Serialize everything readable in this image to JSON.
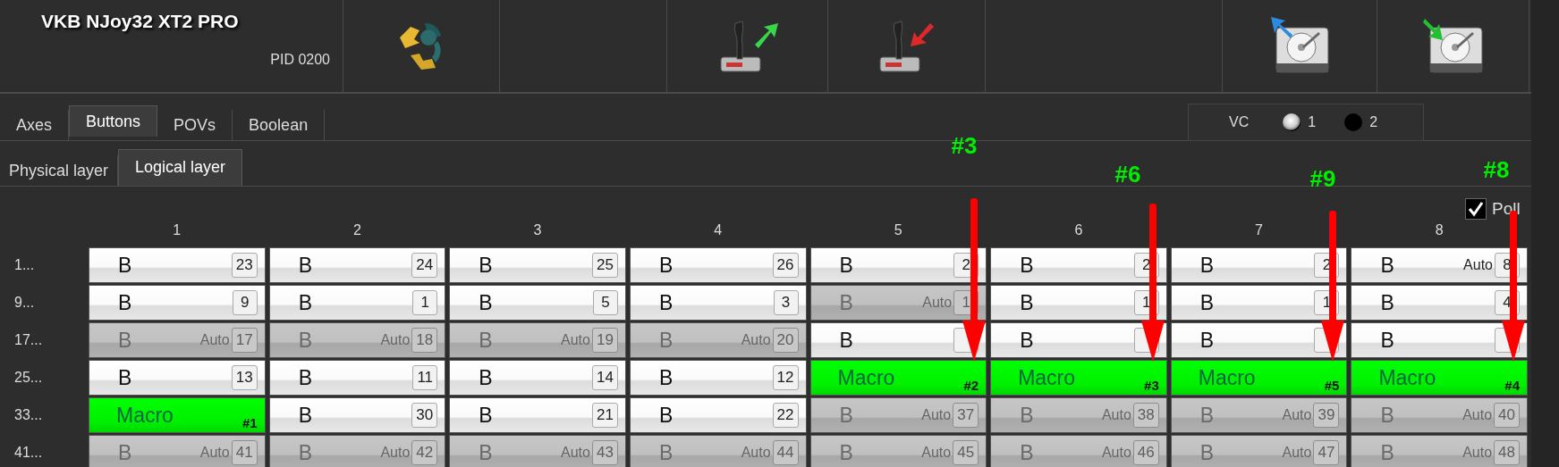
{
  "device": {
    "name": "VKB NJoy32 XT2 PRO",
    "pid": "PID 0200"
  },
  "tabs": [
    {
      "label": "Axes",
      "selected": false
    },
    {
      "label": "Buttons",
      "selected": true
    },
    {
      "label": "POVs",
      "selected": false
    },
    {
      "label": "Boolean",
      "selected": false
    }
  ],
  "vc": {
    "label": "VC",
    "options": [
      {
        "label": "1",
        "selected": true
      },
      {
        "label": "2",
        "selected": false
      }
    ]
  },
  "layer_tabs": [
    {
      "label": "Physical layer",
      "selected": false
    },
    {
      "label": "Logical layer",
      "selected": true
    }
  ],
  "poll": {
    "label": "Poll",
    "checked": true
  },
  "columns": [
    "1",
    "2",
    "3",
    "4",
    "5",
    "6",
    "7",
    "8"
  ],
  "rows": [
    {
      "label": "1...",
      "cells": [
        {
          "kind": "button",
          "text": "B",
          "number": "23",
          "disabled": false
        },
        {
          "kind": "button",
          "text": "B",
          "number": "24",
          "disabled": false
        },
        {
          "kind": "button",
          "text": "B",
          "number": "25",
          "disabled": false
        },
        {
          "kind": "button",
          "text": "B",
          "number": "26",
          "disabled": false
        },
        {
          "kind": "button",
          "text": "B",
          "number": "2",
          "disabled": false
        },
        {
          "kind": "button",
          "text": "B",
          "number": "2",
          "disabled": false
        },
        {
          "kind": "button",
          "text": "B",
          "number": "2",
          "disabled": false
        },
        {
          "kind": "button",
          "text": "B",
          "auto": "Auto",
          "number": "8",
          "disabled": false
        }
      ]
    },
    {
      "label": "9...",
      "cells": [
        {
          "kind": "button",
          "text": "B",
          "number": "9",
          "disabled": false
        },
        {
          "kind": "button",
          "text": "B",
          "number": "1",
          "disabled": false
        },
        {
          "kind": "button",
          "text": "B",
          "number": "5",
          "disabled": false
        },
        {
          "kind": "button",
          "text": "B",
          "number": "3",
          "disabled": false
        },
        {
          "kind": "button",
          "text": "B",
          "auto": "Auto",
          "number": "1",
          "disabled": true
        },
        {
          "kind": "button",
          "text": "B",
          "number": "1",
          "disabled": false
        },
        {
          "kind": "button",
          "text": "B",
          "number": "1",
          "disabled": false
        },
        {
          "kind": "button",
          "text": "B",
          "number": "4",
          "disabled": false
        }
      ]
    },
    {
      "label": "17...",
      "cells": [
        {
          "kind": "button",
          "text": "B",
          "auto": "Auto",
          "number": "17",
          "disabled": true
        },
        {
          "kind": "button",
          "text": "B",
          "auto": "Auto",
          "number": "18",
          "disabled": true
        },
        {
          "kind": "button",
          "text": "B",
          "auto": "Auto",
          "number": "19",
          "disabled": true
        },
        {
          "kind": "button",
          "text": "B",
          "auto": "Auto",
          "number": "20",
          "disabled": true
        },
        {
          "kind": "button",
          "text": "B",
          "disabled": false
        },
        {
          "kind": "button",
          "text": "B",
          "disabled": false
        },
        {
          "kind": "button",
          "text": "B",
          "disabled": false
        },
        {
          "kind": "button",
          "text": "B",
          "disabled": false
        }
      ]
    },
    {
      "label": "25...",
      "cells": [
        {
          "kind": "button",
          "text": "B",
          "number": "13",
          "disabled": false
        },
        {
          "kind": "button",
          "text": "B",
          "number": "11",
          "disabled": false
        },
        {
          "kind": "button",
          "text": "B",
          "number": "14",
          "disabled": false
        },
        {
          "kind": "button",
          "text": "B",
          "number": "12",
          "disabled": false
        },
        {
          "kind": "macro",
          "text": "Macro",
          "tag": "#2"
        },
        {
          "kind": "macro",
          "text": "Macro",
          "tag": "#3"
        },
        {
          "kind": "macro",
          "text": "Macro",
          "tag": "#5"
        },
        {
          "kind": "macro",
          "text": "Macro",
          "tag": "#4"
        }
      ]
    },
    {
      "label": "33...",
      "cells": [
        {
          "kind": "macro",
          "text": "Macro",
          "tag": "#1"
        },
        {
          "kind": "button",
          "text": "B",
          "number": "30",
          "disabled": false
        },
        {
          "kind": "button",
          "text": "B",
          "number": "21",
          "disabled": false
        },
        {
          "kind": "button",
          "text": "B",
          "number": "22",
          "disabled": false
        },
        {
          "kind": "button",
          "text": "B",
          "auto": "Auto",
          "number": "37",
          "disabled": true
        },
        {
          "kind": "button",
          "text": "B",
          "auto": "Auto",
          "number": "38",
          "disabled": true
        },
        {
          "kind": "button",
          "text": "B",
          "auto": "Auto",
          "number": "39",
          "disabled": true
        },
        {
          "kind": "button",
          "text": "B",
          "auto": "Auto",
          "number": "40",
          "disabled": true
        }
      ]
    },
    {
      "label": "41...",
      "cells": [
        {
          "kind": "button",
          "text": "B",
          "auto": "Auto",
          "number": "41",
          "disabled": true
        },
        {
          "kind": "button",
          "text": "B",
          "auto": "Auto",
          "number": "42",
          "disabled": true
        },
        {
          "kind": "button",
          "text": "B",
          "auto": "Auto",
          "number": "43",
          "disabled": true
        },
        {
          "kind": "button",
          "text": "B",
          "auto": "Auto",
          "number": "44",
          "disabled": true
        },
        {
          "kind": "button",
          "text": "B",
          "auto": "Auto",
          "number": "45",
          "disabled": true
        },
        {
          "kind": "button",
          "text": "B",
          "auto": "Auto",
          "number": "46",
          "disabled": true
        },
        {
          "kind": "button",
          "text": "B",
          "auto": "Auto",
          "number": "47",
          "disabled": true
        },
        {
          "kind": "button",
          "text": "B",
          "auto": "Auto",
          "number": "48",
          "disabled": true
        }
      ]
    }
  ],
  "annotations": [
    {
      "label": "#3"
    },
    {
      "label": "#6"
    },
    {
      "label": "#9"
    },
    {
      "label": "#8"
    }
  ]
}
